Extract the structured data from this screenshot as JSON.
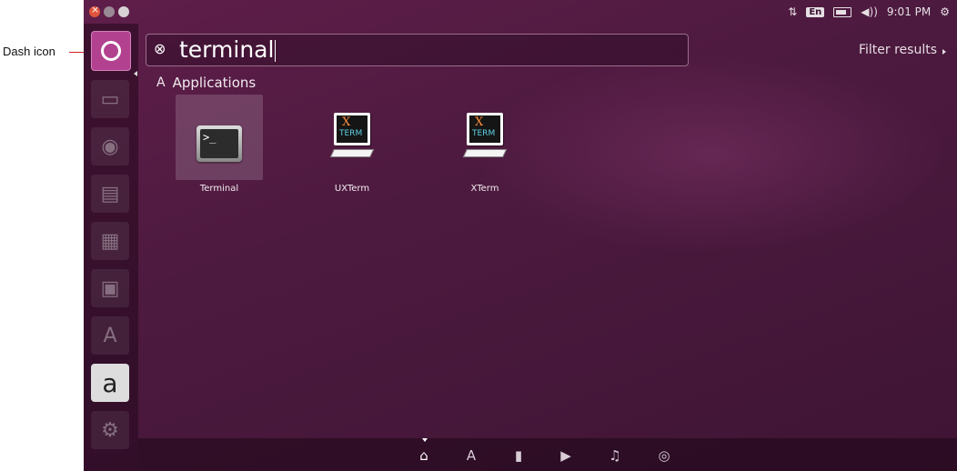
{
  "annotation": {
    "label": "Dash icon",
    "color": "#d02020"
  },
  "topbar": {
    "network": "⇅",
    "keyboard": "En",
    "volume": "◀))",
    "time": "9:01 PM",
    "gear": "⚙"
  },
  "launcher": {
    "items": [
      {
        "name": "dash",
        "glyph": ""
      },
      {
        "name": "files",
        "glyph": "▭"
      },
      {
        "name": "firefox",
        "glyph": "◉"
      },
      {
        "name": "writer",
        "glyph": "▤"
      },
      {
        "name": "calc",
        "glyph": "▦"
      },
      {
        "name": "impress",
        "glyph": "▣"
      },
      {
        "name": "software-center",
        "glyph": "A"
      },
      {
        "name": "amazon",
        "glyph": "a"
      },
      {
        "name": "settings",
        "glyph": "⚙"
      }
    ]
  },
  "search": {
    "query": "terminal",
    "clear_glyph": "⊗"
  },
  "filter": {
    "label": "Filter results"
  },
  "section": {
    "title": "Applications",
    "icon": "A"
  },
  "results": [
    {
      "label": "Terminal",
      "selected": true
    },
    {
      "label": "UXTerm",
      "selected": false
    },
    {
      "label": "XTerm",
      "selected": false
    }
  ],
  "xterm_icon": {
    "x": "X",
    "t": "TERM"
  },
  "terminal_icon": {
    "prompt": ">_"
  },
  "lenses": [
    {
      "name": "home",
      "glyph": "⌂",
      "active": true
    },
    {
      "name": "applications",
      "glyph": "A",
      "active": false
    },
    {
      "name": "files",
      "glyph": "▮",
      "active": false
    },
    {
      "name": "video",
      "glyph": "▶",
      "active": false
    },
    {
      "name": "music",
      "glyph": "♫",
      "active": false
    },
    {
      "name": "photos",
      "glyph": "◎",
      "active": false
    }
  ]
}
